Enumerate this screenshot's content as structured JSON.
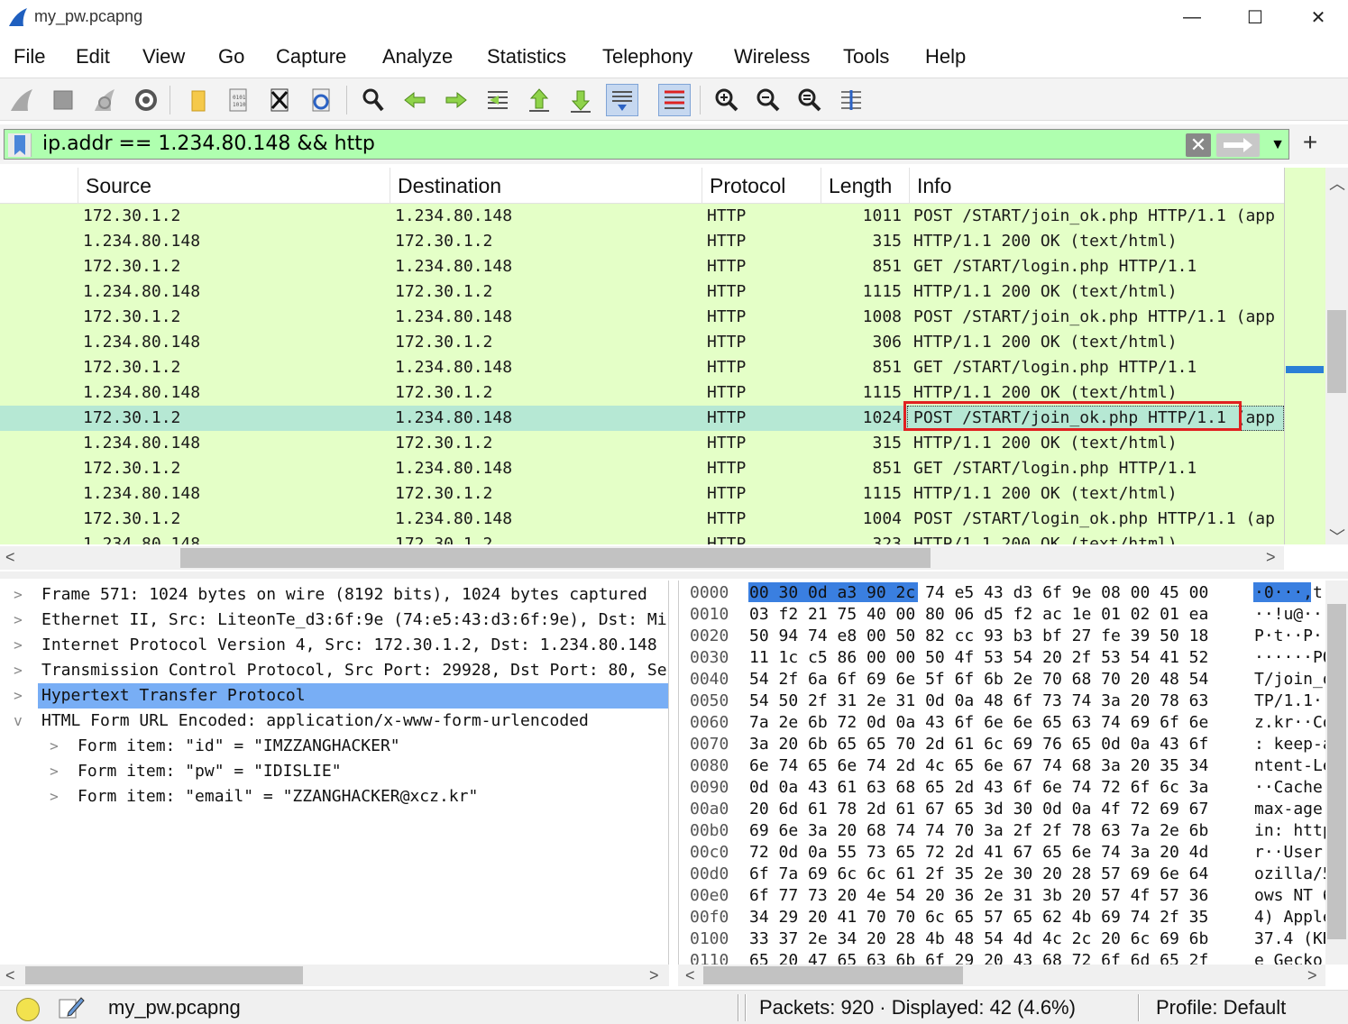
{
  "window": {
    "title": "my_pw.pcapng",
    "minimize": "—",
    "maximize": "☐",
    "close": "✕"
  },
  "menu": [
    "File",
    "Edit",
    "View",
    "Go",
    "Capture",
    "Analyze",
    "Statistics",
    "Telephony",
    "Wireless",
    "Tools",
    "Help"
  ],
  "toolbar_icons": [
    "shark-fin-icon",
    "stop-icon",
    "restart-icon",
    "options-gear-icon",
    "open-folder-icon",
    "save-file-icon",
    "close-file-icon",
    "reload-icon",
    "find-icon",
    "back-arrow-icon",
    "forward-arrow-icon",
    "go-to-packet-icon",
    "first-packet-icon",
    "last-packet-icon",
    "autoscroll-icon",
    "colorize-icon",
    "zoom-in-icon",
    "zoom-out-icon",
    "normal-size-icon",
    "resize-columns-icon"
  ],
  "filter": {
    "value": "ip.addr == 1.234.80.148 && http",
    "color": "#afffaf"
  },
  "packet_list": {
    "columns": [
      "Source",
      "Destination",
      "Protocol",
      "Length",
      "Info"
    ],
    "rows": [
      {
        "src": "172.30.1.2",
        "dst": "1.234.80.148",
        "proto": "HTTP",
        "len": "1011",
        "info": "POST /START/join_ok.php HTTP/1.1  (app"
      },
      {
        "src": "1.234.80.148",
        "dst": "172.30.1.2",
        "proto": "HTTP",
        "len": "315",
        "info": "HTTP/1.1 200 OK  (text/html)"
      },
      {
        "src": "172.30.1.2",
        "dst": "1.234.80.148",
        "proto": "HTTP",
        "len": "851",
        "info": "GET /START/login.php HTTP/1.1"
      },
      {
        "src": "1.234.80.148",
        "dst": "172.30.1.2",
        "proto": "HTTP",
        "len": "1115",
        "info": "HTTP/1.1 200 OK  (text/html)"
      },
      {
        "src": "172.30.1.2",
        "dst": "1.234.80.148",
        "proto": "HTTP",
        "len": "1008",
        "info": "POST /START/join_ok.php HTTP/1.1  (app"
      },
      {
        "src": "1.234.80.148",
        "dst": "172.30.1.2",
        "proto": "HTTP",
        "len": "306",
        "info": "HTTP/1.1 200 OK  (text/html)"
      },
      {
        "src": "172.30.1.2",
        "dst": "1.234.80.148",
        "proto": "HTTP",
        "len": "851",
        "info": "GET /START/login.php HTTP/1.1"
      },
      {
        "src": "1.234.80.148",
        "dst": "172.30.1.2",
        "proto": "HTTP",
        "len": "1115",
        "info": "HTTP/1.1 200 OK  (text/html)"
      },
      {
        "src": "172.30.1.2",
        "dst": "1.234.80.148",
        "proto": "HTTP",
        "len": "1024",
        "info": "POST /START/join_ok.php HTTP/1.1  (app"
      },
      {
        "src": "1.234.80.148",
        "dst": "172.30.1.2",
        "proto": "HTTP",
        "len": "315",
        "info": "HTTP/1.1 200 OK  (text/html)"
      },
      {
        "src": "172.30.1.2",
        "dst": "1.234.80.148",
        "proto": "HTTP",
        "len": "851",
        "info": "GET /START/login.php HTTP/1.1"
      },
      {
        "src": "1.234.80.148",
        "dst": "172.30.1.2",
        "proto": "HTTP",
        "len": "1115",
        "info": "HTTP/1.1 200 OK  (text/html)"
      },
      {
        "src": "172.30.1.2",
        "dst": "1.234.80.148",
        "proto": "HTTP",
        "len": "1004",
        "info": "POST /START/login_ok.php HTTP/1.1  (ap"
      },
      {
        "src": "1.234.80.148",
        "dst": "172.30.1.2",
        "proto": "HTTP",
        "len": "323",
        "info": "HTTP/1.1 200 OK  (text/html)"
      }
    ],
    "selected_index": 8,
    "row_color": "#e4ffc7",
    "selected_color": "#b6e8d4",
    "annotation_color": "#e02020"
  },
  "details": [
    {
      "exp": ">",
      "text": "Frame 571: 1024 bytes on wire (8192 bits), 1024 bytes captured"
    },
    {
      "exp": ">",
      "text": "Ethernet II, Src: LiteonTe_d3:6f:9e (74:e5:43:d3:6f:9e), Dst: Mi"
    },
    {
      "exp": ">",
      "text": "Internet Protocol Version 4, Src: 172.30.1.2, Dst: 1.234.80.148"
    },
    {
      "exp": ">",
      "text": "Transmission Control Protocol, Src Port: 29928, Dst Port: 80, Se"
    },
    {
      "exp": ">",
      "text": "Hypertext Transfer Protocol"
    },
    {
      "exp": "v",
      "text": "HTML Form URL Encoded: application/x-www-form-urlencoded"
    },
    {
      "exp": ">",
      "text": "Form item: \"id\" = \"IMZZANGHACKER\""
    },
    {
      "exp": ">",
      "text": "Form item: \"pw\" = \"IDISLIE\""
    },
    {
      "exp": ">",
      "text": "Form item: \"email\" = \"ZZANGHACKER@xcz.kr\""
    }
  ],
  "bytes": [
    {
      "off": "0000",
      "hex": "00 30 0d a3 90 2c 74 e5  43 d3 6f 9e 08 00 45 00",
      "asc": "·0···,t"
    },
    {
      "off": "0010",
      "hex": "03 f2 21 75 40 00 80 06  d5 f2 ac 1e 01 02 01 ea",
      "asc": "··!u@··"
    },
    {
      "off": "0020",
      "hex": "50 94 74 e8 00 50 82 cc  93 b3 bf 27 fe 39 50 18",
      "asc": "P·t··P·"
    },
    {
      "off": "0030",
      "hex": "11 1c c5 86 00 00 50 4f  53 54 20 2f 53 54 41 52",
      "asc": "······PO"
    },
    {
      "off": "0040",
      "hex": "54 2f 6a 6f 69 6e 5f 6f  6b 2e 70 68 70 20 48 54",
      "asc": "T/join_o"
    },
    {
      "off": "0050",
      "hex": "54 50 2f 31 2e 31 0d 0a  48 6f 73 74 3a 20 78 63",
      "asc": "TP/1.1··"
    },
    {
      "off": "0060",
      "hex": "7a 2e 6b 72 0d 0a 43 6f  6e 6e 65 63 74 69 6f 6e",
      "asc": "z.kr··Co"
    },
    {
      "off": "0070",
      "hex": "3a 20 6b 65 65 70 2d 61  6c 69 76 65 0d 0a 43 6f",
      "asc": ": keep-a"
    },
    {
      "off": "0080",
      "hex": "6e 74 65 6e 74 2d 4c 65  6e 67 74 68 3a 20 35 34",
      "asc": "ntent-Le"
    },
    {
      "off": "0090",
      "hex": "0d 0a 43 61 63 68 65 2d  43 6f 6e 74 72 6f 6c 3a",
      "asc": "··Cache-"
    },
    {
      "off": "00a0",
      "hex": "20 6d 61 78 2d 61 67 65  3d 30 0d 0a 4f 72 69 67",
      "asc": " max-age"
    },
    {
      "off": "00b0",
      "hex": "69 6e 3a 20 68 74 74 70  3a 2f 2f 78 63 7a 2e 6b",
      "asc": "in: http"
    },
    {
      "off": "00c0",
      "hex": "72 0d 0a 55 73 65 72 2d  41 67 65 6e 74 3a 20 4d",
      "asc": "r··User-"
    },
    {
      "off": "00d0",
      "hex": "6f 7a 69 6c 6c 61 2f 35  2e 30 20 28 57 69 6e 64",
      "asc": "ozilla/5"
    },
    {
      "off": "00e0",
      "hex": "6f 77 73 20 4e 54 20 36  2e 31 3b 20 57 4f 57 36",
      "asc": "ows NT 6"
    },
    {
      "off": "00f0",
      "hex": "34 29 20 41 70 70 6c 65  57 65 62 4b 69 74 2f 35",
      "asc": "4) Apple"
    },
    {
      "off": "0100",
      "hex": "33 37 2e 34 20 28 4b 48  54 4d 4c 2c 20 6c 69 6b",
      "asc": "37.4 (KH"
    },
    {
      "off": "0110",
      "hex": "65 20 47 65 63 6b 6f 29  20 43 68 72 6f 6d 65 2f",
      "asc": "e Gecko)"
    }
  ],
  "status": {
    "file": "my_pw.pcapng",
    "packets": "Packets: 920 · Displayed: 42 (4.6%)",
    "profile": "Profile: Default"
  }
}
